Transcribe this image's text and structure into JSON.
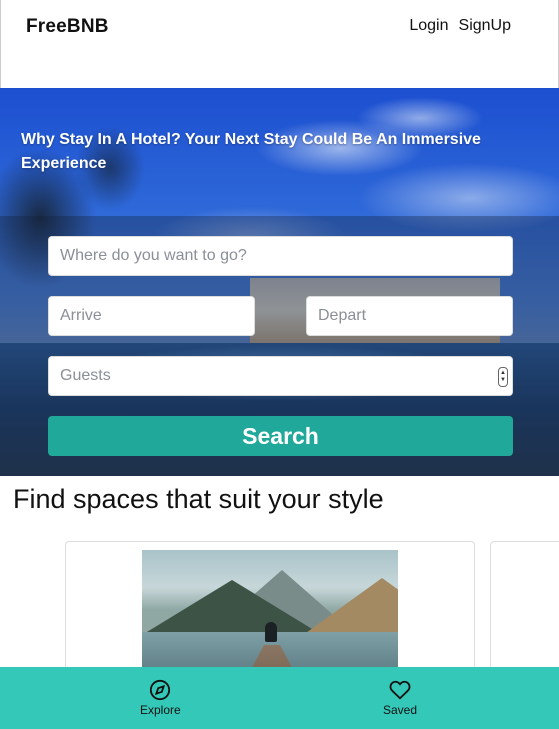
{
  "header": {
    "brand": "FreeBNB",
    "nav": {
      "login": "Login",
      "signup": "SignUp"
    }
  },
  "hero": {
    "title": "Why Stay In A Hotel? Your Next Stay Could Be An Immersive Experience",
    "search": {
      "where_placeholder": "Where do you want to go?",
      "arrive_placeholder": "Arrive",
      "depart_placeholder": "Depart",
      "guests_placeholder": "Guests",
      "search_label": "Search"
    }
  },
  "section": {
    "title": "Find spaces that suit your style"
  },
  "bottom_nav": {
    "items": [
      {
        "label": "Explore",
        "icon": "compass-icon"
      },
      {
        "label": "Saved",
        "icon": "heart-icon"
      }
    ]
  },
  "colors": {
    "search_button": "#20a99a",
    "bottom_nav": "#34c8b8"
  }
}
